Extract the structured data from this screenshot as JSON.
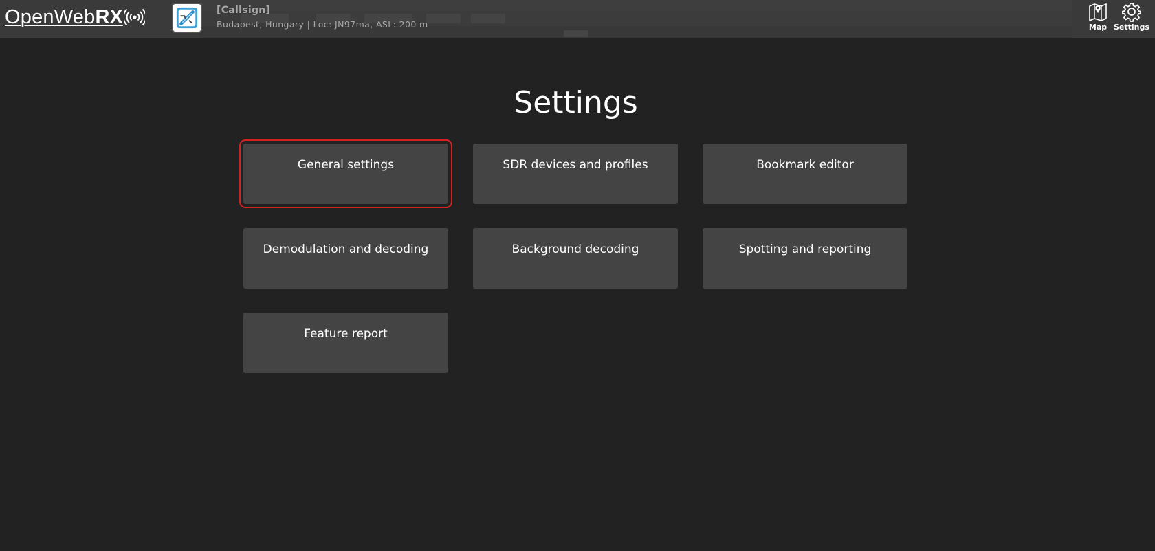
{
  "header": {
    "brand": {
      "open": "Open",
      "web": "Web",
      "rx": "RX"
    },
    "receiver": {
      "callsign": "[Callsign]",
      "location": "Budapest, Hungary | Loc: JN97ma, ASL: 200 m"
    },
    "nav": {
      "map_label": "Map",
      "settings_label": "Settings"
    }
  },
  "main": {
    "title": "Settings",
    "tiles": [
      {
        "label": "General settings",
        "selected": true
      },
      {
        "label": "SDR devices and profiles"
      },
      {
        "label": "Bookmark editor"
      },
      {
        "label": "Demodulation and decoding"
      },
      {
        "label": "Background decoding"
      },
      {
        "label": "Spotting and reporting"
      },
      {
        "label": "Feature report"
      }
    ]
  },
  "colors": {
    "background": "#222222",
    "header": "#3a3a3a",
    "tile": "#444444",
    "selection_outline": "#d42222",
    "receiver_text": "#a9a9a9"
  },
  "icons": {
    "brand": "radio-waves-icon",
    "receiver": "receiver-avatar-icon",
    "map": "map-icon",
    "settings": "gear-icon"
  }
}
